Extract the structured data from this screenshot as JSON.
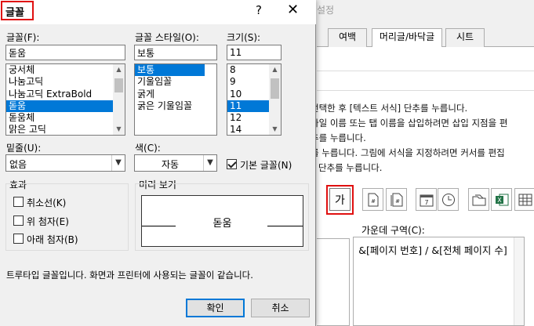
{
  "bg_dialog": {
    "title_partial": "설정",
    "tabs": [
      "여백",
      "머리글/바닥글",
      "시트"
    ],
    "instructions": [
      "선택한 후 [텍스트 서식] 단추를 누릅니다.",
      "타일 이름 또는 탭 이름을 삽입하려면 삽입 지점을 편",
      "추를 누릅니다.",
      "를 누릅니다. 그림에 서식을 지정하려면 커서를 편집",
      "단추를 누릅니다."
    ],
    "font_button_glyph": "가",
    "center_section_label": "가운데 구역(C):",
    "center_section_text": "&[페이지 번호] / &[전체 페이지 수]"
  },
  "font_dialog": {
    "title": "글꼴",
    "help_glyph": "?",
    "close_glyph": "✕",
    "font": {
      "label": "글꼴(F):",
      "value": "돋움",
      "items": [
        "궁서체",
        "나눔고딕",
        "나눔고딕 ExtraBold",
        "돋움",
        "돋움체",
        "맑은 고딕"
      ],
      "selected_index": 3
    },
    "style": {
      "label": "글꼴 스타일(O):",
      "value": "보통",
      "items": [
        "보통",
        "기울임꼴",
        "굵게",
        "굵은 기울임꼴"
      ],
      "selected_index": 0
    },
    "size": {
      "label": "크기(S):",
      "value": "11",
      "items": [
        "8",
        "9",
        "10",
        "11",
        "12",
        "14"
      ],
      "selected_index": 3
    },
    "underline": {
      "label": "밑줄(U):",
      "value": "없음"
    },
    "color": {
      "label": "색(C):",
      "value": "자동"
    },
    "normal_font": {
      "label": "기본 글꼴(N)",
      "checked": true
    },
    "effects": {
      "label": "효과",
      "items": [
        {
          "label": "취소선(K)",
          "checked": false
        },
        {
          "label": "위 첨자(E)",
          "checked": false
        },
        {
          "label": "아래 첨자(B)",
          "checked": false
        }
      ]
    },
    "preview": {
      "label": "미리 보기",
      "sample": "돋움"
    },
    "description": "트루타입 글꼴입니다. 화면과 프린터에 사용되는 글꼴이 같습니다.",
    "ok_label": "확인",
    "cancel_label": "취소"
  },
  "colors": {
    "highlight": "#e01010",
    "selection": "#0078d7"
  }
}
